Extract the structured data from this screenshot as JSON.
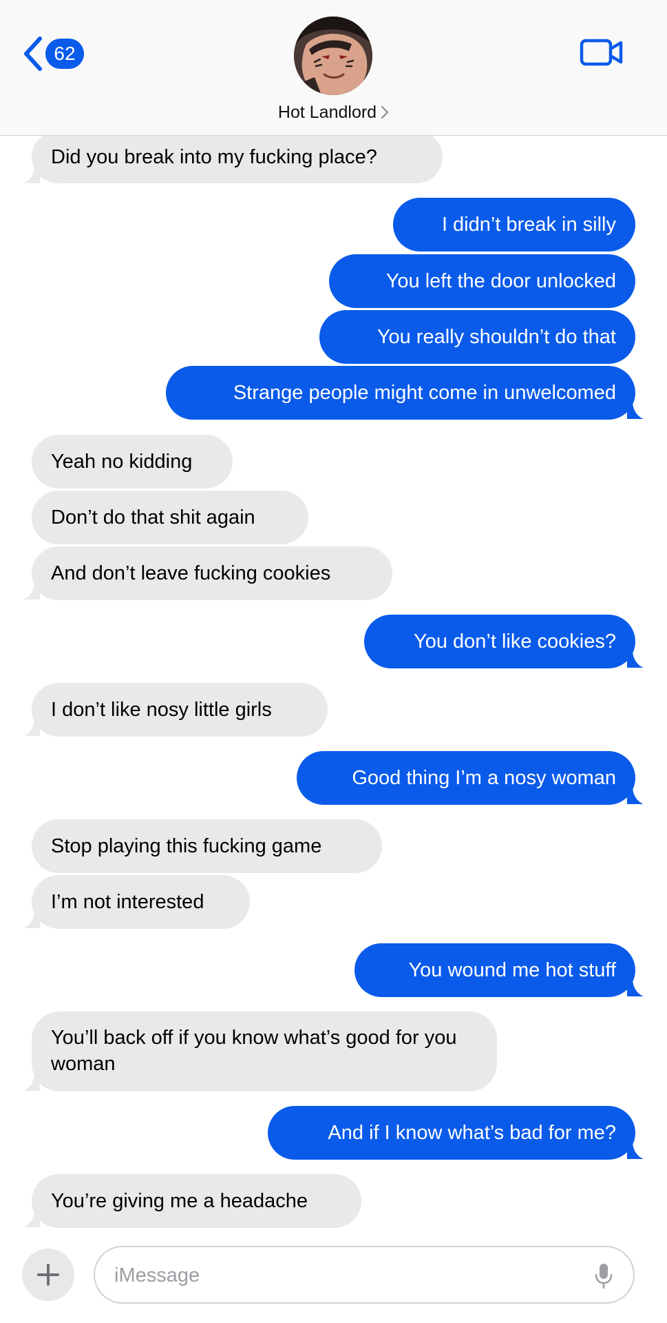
{
  "header": {
    "back_badge_count": "62",
    "contact_name": "Hot Landlord"
  },
  "messages": [
    {
      "from": "contact",
      "text": "Did you break into my fucking place?"
    },
    {
      "from": "me",
      "text": "I didn’t break in silly"
    },
    {
      "from": "me",
      "text": "You left the door unlocked"
    },
    {
      "from": "me",
      "text": "You really shouldn’t do that"
    },
    {
      "from": "me",
      "text": "Strange people might come in unwelcomed"
    },
    {
      "from": "contact",
      "text": "Yeah no kidding"
    },
    {
      "from": "contact",
      "text": "Don’t do that shit again"
    },
    {
      "from": "contact",
      "text": "And don’t leave fucking cookies"
    },
    {
      "from": "me",
      "text": "You don’t like cookies?"
    },
    {
      "from": "contact",
      "text": "I don’t like nosy little girls"
    },
    {
      "from": "me",
      "text": "Good thing I’m a nosy woman"
    },
    {
      "from": "contact",
      "text": "Stop playing this fucking game"
    },
    {
      "from": "contact",
      "text": "I’m not interested"
    },
    {
      "from": "me",
      "text": "You wound me hot stuff"
    },
    {
      "from": "contact",
      "text": "You’ll back off if you know what’s good for you woman"
    },
    {
      "from": "me",
      "text": "And if I know what’s bad for me?"
    },
    {
      "from": "contact",
      "text": "You’re giving me a headache"
    }
  ],
  "composer": {
    "placeholder": "iMessage"
  },
  "colors": {
    "outgoing_bubble": "#0a5bea",
    "incoming_bubble": "#e9e9eb",
    "accent": "#0a5bea"
  },
  "icons": {
    "back": "chevron-left-icon",
    "video": "video-camera-icon",
    "plus": "plus-icon",
    "mic": "microphone-icon"
  }
}
